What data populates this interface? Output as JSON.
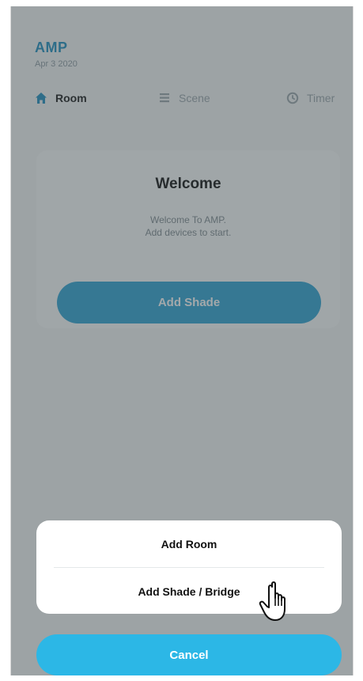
{
  "app": {
    "title": "AMP",
    "date": "Apr 3 2020"
  },
  "tabs": [
    {
      "label": "Room",
      "icon": "home-icon",
      "active": true
    },
    {
      "label": "Scene",
      "icon": "scene-icon",
      "active": false
    },
    {
      "label": "Timer",
      "icon": "timer-icon",
      "active": false
    }
  ],
  "welcome": {
    "title": "Welcome",
    "line1": "Welcome To AMP.",
    "line2": "Add devices to start."
  },
  "add_shade_button": "Add Shade",
  "action_sheet": {
    "items": [
      "Add Room",
      "Add Shade / Bridge"
    ],
    "cancel": "Cancel"
  },
  "colors": {
    "accent": "#2fa3d4",
    "cancel": "#2cb7e6",
    "title": "#1f8fc0"
  }
}
